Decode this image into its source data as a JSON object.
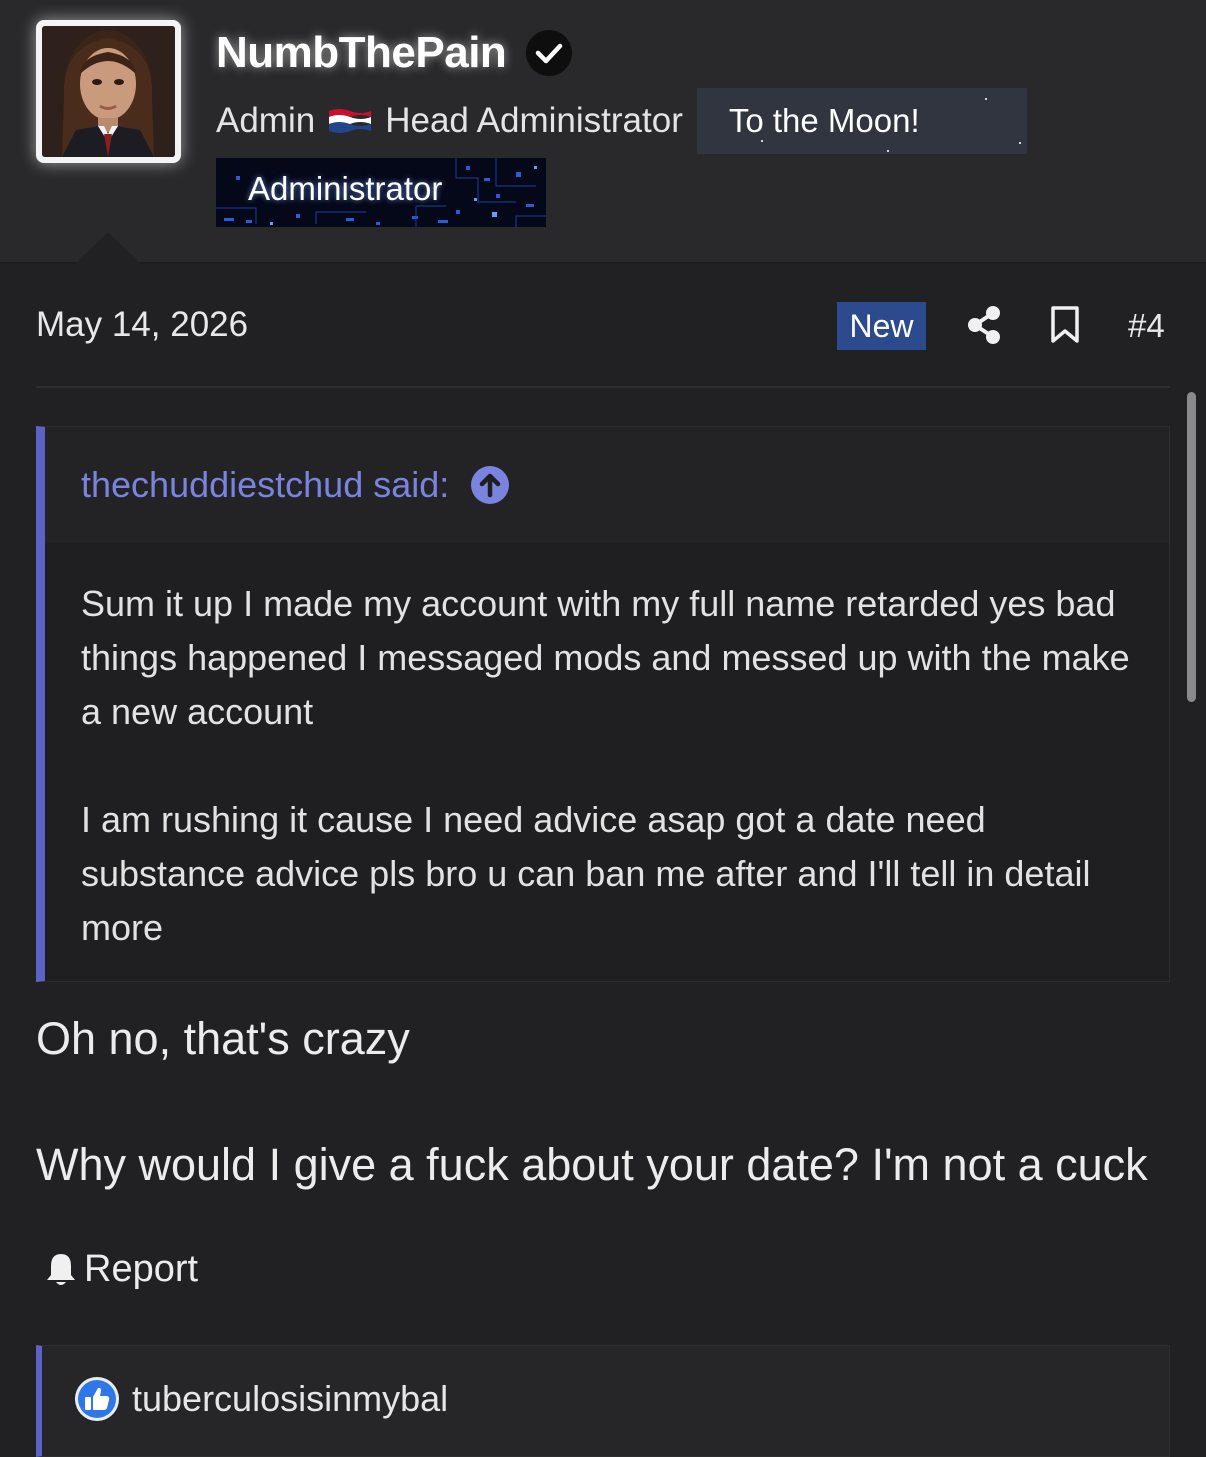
{
  "user": {
    "name": "NumbThePain",
    "title": "Admin",
    "flag_icon": "netherlands-flag-icon",
    "role": "Head Administrator",
    "banner_text": "To the Moon!",
    "group_banner": "Administrator",
    "verified_icon": "check-circle-icon"
  },
  "post": {
    "date": "May 14, 2026",
    "new_badge": "New",
    "number": "#4"
  },
  "quote": {
    "author": "thechuddiestchud said:",
    "paragraphs": [
      "Sum it up I made my account with my full name retarded yes bad things happened I messaged mods and messed up with the make a new account",
      "I am rushing it cause I need advice asap got a date need substance advice pls bro u can ban me after and I'll tell in detail more"
    ]
  },
  "reply": {
    "line1": "Oh no, that's crazy",
    "line2": "Why would I give a fuck about your date? I'm not a cuck"
  },
  "actions": {
    "report": "Report"
  },
  "reactions": {
    "icon": "thumbs-up-icon",
    "users": "tuberculosisinmybal"
  },
  "colors": {
    "background": "#212123",
    "quote_accent": "#5b63c4",
    "quote_author": "#7a83de",
    "new_badge": "#2c4a8e"
  }
}
